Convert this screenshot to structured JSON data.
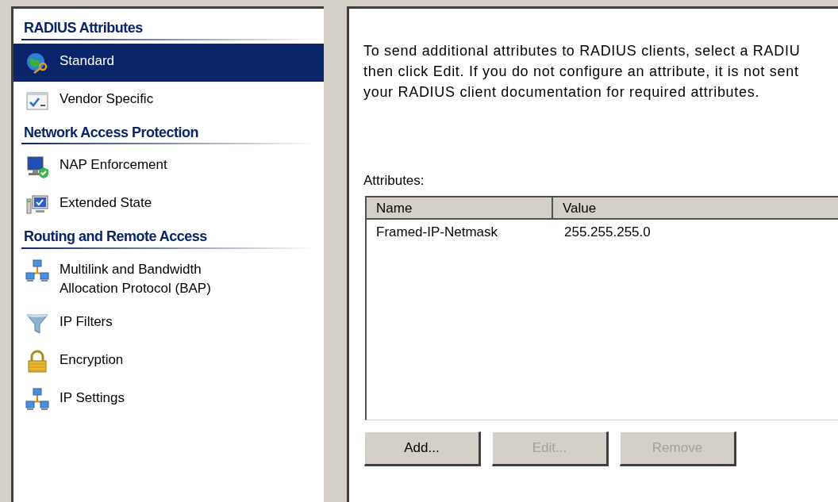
{
  "sidebar": {
    "sections": [
      {
        "heading": "RADIUS Attributes",
        "items": [
          {
            "label": "Standard",
            "kind": "globe-key",
            "selected": true
          },
          {
            "label": "Vendor Specific",
            "kind": "checklist",
            "selected": false
          }
        ]
      },
      {
        "heading": "Network Access Protection",
        "items": [
          {
            "label": "NAP Enforcement",
            "kind": "monitor-check",
            "selected": false
          },
          {
            "label": "Extended State",
            "kind": "computer",
            "selected": false
          }
        ]
      },
      {
        "heading": "Routing and Remote Access",
        "items": [
          {
            "label": "Multilink and Bandwidth Allocation Protocol (BAP)",
            "kind": "network",
            "selected": false
          },
          {
            "label": "IP Filters",
            "kind": "funnel",
            "selected": false
          },
          {
            "label": "Encryption",
            "kind": "padlock",
            "selected": false
          },
          {
            "label": "IP Settings",
            "kind": "network",
            "selected": false
          }
        ]
      }
    ]
  },
  "description": [
    "To send additional attributes to RADIUS clients, select a RADIU",
    "then click Edit. If you do not configure an attribute, it is not sent",
    "your RADIUS client documentation for required attributes."
  ],
  "attributes": {
    "label": "Attributes:",
    "columns": [
      "Name",
      "Value"
    ],
    "rows": [
      [
        "Framed-IP-Netmask",
        "255.255.255.0"
      ]
    ]
  },
  "buttons": [
    {
      "label": "Add...",
      "disabled": false
    },
    {
      "label": "Edit...",
      "disabled": true
    },
    {
      "label": "Remove",
      "disabled": true
    }
  ]
}
